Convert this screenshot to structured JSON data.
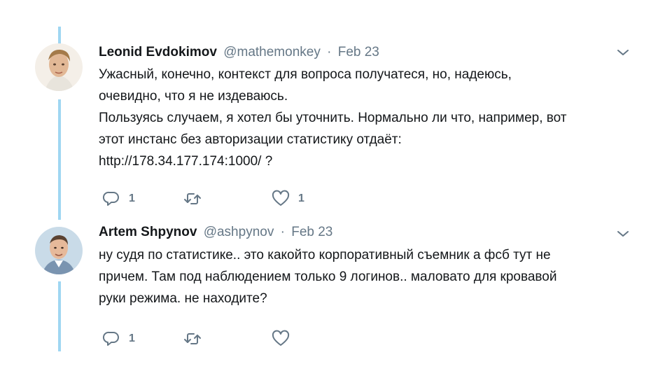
{
  "tweets": [
    {
      "name": "Leonid Evdokimov",
      "handle": "@mathemonkey",
      "separator": "·",
      "date": "Feb 23",
      "lines": [
        "Ужасный, конечно, контекст для вопроса получатеся, но, надеюсь,",
        "очевидно, что я не издеваюсь.",
        "Пользуясь случаем, я хотел бы уточнить. Нормально ли что, например, вот",
        "этот инстанс без авторизации статистику отдаёт:",
        "http://178.34.177.174:1000/ ?"
      ],
      "reply_count": "1",
      "retweet_count": "",
      "like_count": "1"
    },
    {
      "name": "Artem Shpynov",
      "handle": "@ashpynov",
      "separator": "·",
      "date": "Feb 23",
      "lines": [
        "ну судя по статистике.. это какойто корпоративный съемник а фсб тут не",
        "причем. Там под наблюдением только 9 логинов.. маловато для кровавой",
        "руки режима. не находите?"
      ],
      "reply_count": "1",
      "retweet_count": "",
      "like_count": ""
    }
  ],
  "icons": {
    "reply": "reply-icon",
    "retweet": "retweet-icon",
    "like": "heart-icon",
    "caret": "chevron-down-icon"
  },
  "colors": {
    "thread_line": "#9fd6f2",
    "secondary_text": "#657786",
    "primary_text": "#14171a"
  }
}
